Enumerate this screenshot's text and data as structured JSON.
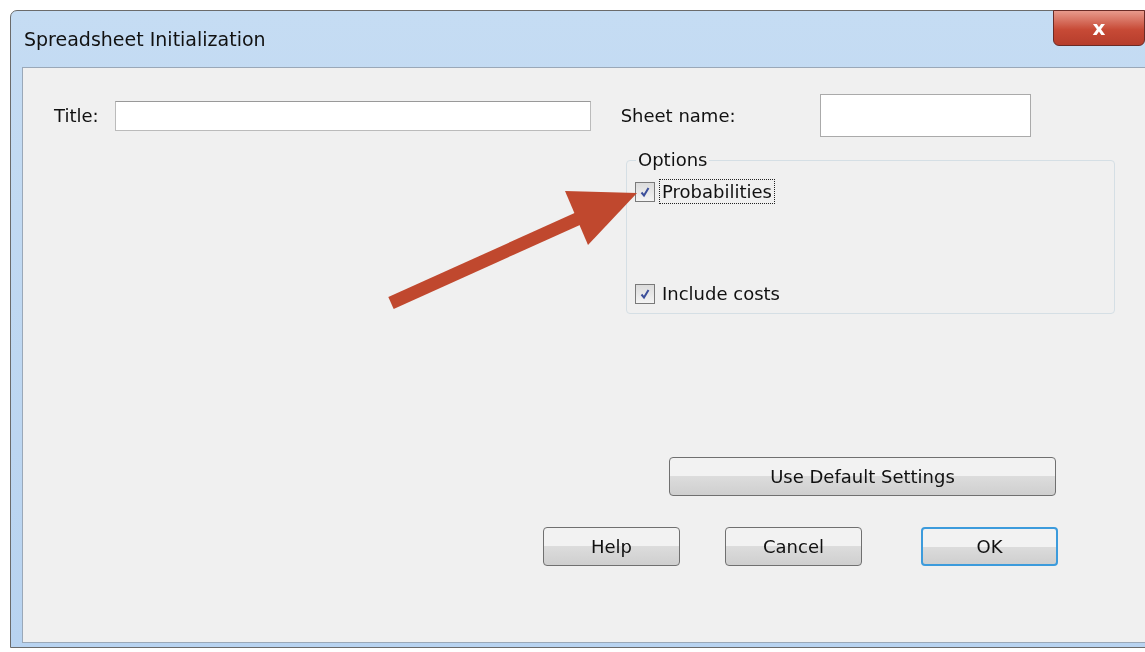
{
  "window": {
    "title": "Spreadsheet Initialization",
    "close": "x"
  },
  "title_field": {
    "label": "Title:"
  },
  "sheet_name_field": {
    "label": "Sheet name:"
  },
  "options": {
    "label": "Options",
    "items": [
      {
        "label": "Probabilities",
        "checked": true,
        "focused": true
      },
      {
        "label": "Include costs",
        "checked": true,
        "focused": false
      }
    ]
  },
  "buttons": [
    {
      "label": "Use Default Settings",
      "kind": "wide",
      "default": false
    },
    {
      "label": "Help",
      "kind": "normal",
      "default": false
    },
    {
      "label": "Cancel",
      "kind": "normal",
      "default": false
    },
    {
      "label": "OK",
      "kind": "normal",
      "default": true
    }
  ],
  "annotation": {
    "kind": "arrow"
  }
}
